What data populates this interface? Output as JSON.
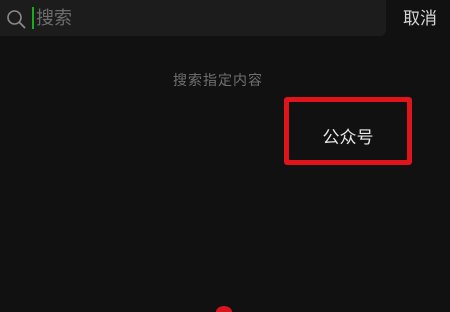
{
  "search": {
    "placeholder": "搜索",
    "value": "",
    "cursor_color": "#1aad19"
  },
  "header": {
    "cancel_label": "取消"
  },
  "main": {
    "hint": "搜索指定内容",
    "categories": [
      {
        "label": "公众号"
      }
    ]
  },
  "icons": {
    "search": "search-icon"
  },
  "colors": {
    "background": "#111111",
    "search_bar": "#1c1c1c",
    "highlight": "#e0141b"
  }
}
